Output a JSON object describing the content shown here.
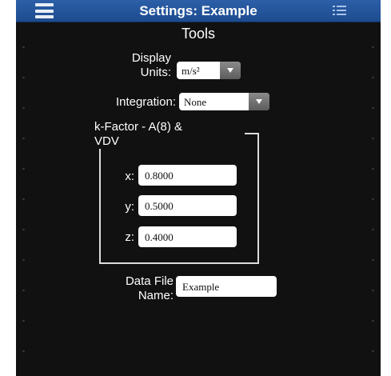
{
  "header": {
    "title": "Settings: Example",
    "subtitle": "Tools"
  },
  "display_units": {
    "label_line1": "Display",
    "label_line2": "Units:",
    "value": "m/s²"
  },
  "integration": {
    "label": "Integration:",
    "value": "None"
  },
  "k_factor": {
    "legend_line1": "k-Factor - A(8) &",
    "legend_line2": "VDV",
    "x_label": "x:",
    "x_value": "0.8000",
    "y_label": "y:",
    "y_value": "0.5000",
    "z_label": "z:",
    "z_value": "0.4000"
  },
  "data_file": {
    "label_line1": "Data File",
    "label_line2": "Name:",
    "value": "Example"
  },
  "colors": {
    "topbar": "#1d4b8f",
    "background": "#111111",
    "text": "#ffffff"
  },
  "icons": [
    "hamburger-menu-icon",
    "list-icon",
    "dropdown-arrow-icon"
  ]
}
